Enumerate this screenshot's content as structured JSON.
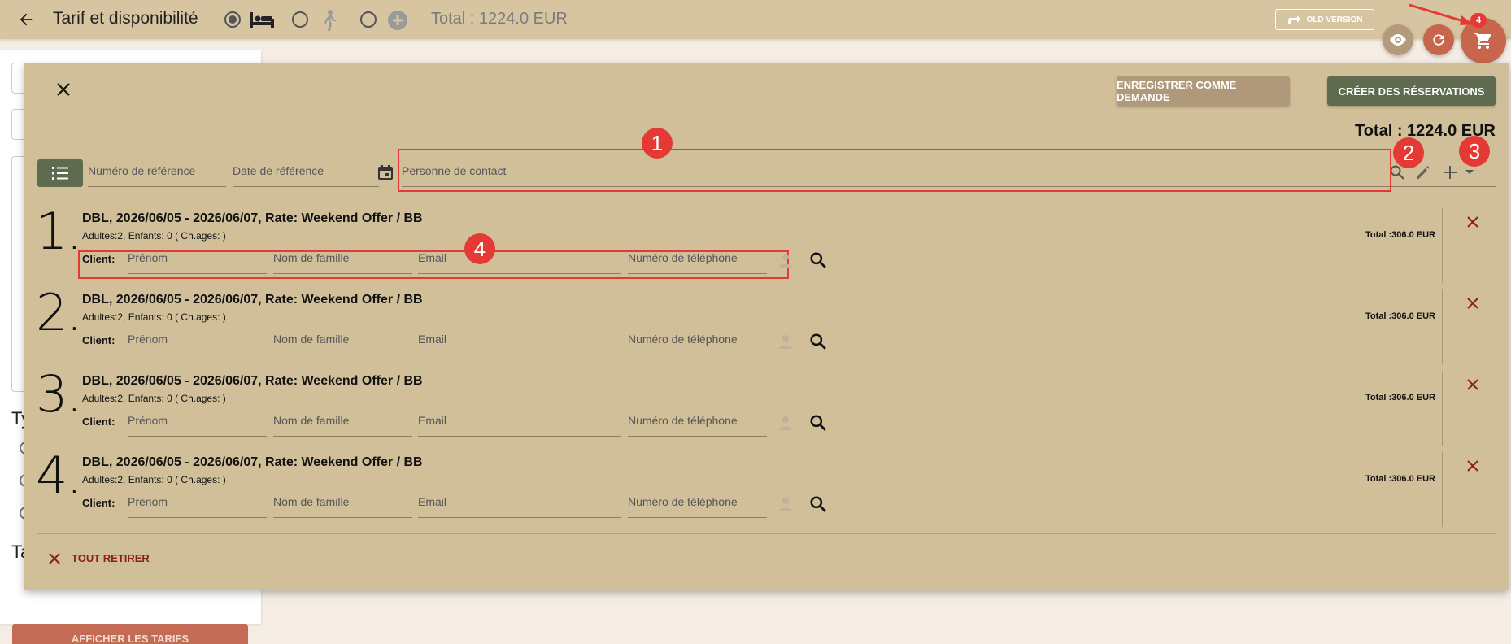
{
  "topbar": {
    "title": "Tarif et disponibilité",
    "total": "Total : 1224.0 EUR",
    "old_version_label": "OLD VERSION",
    "cart_badge": "4",
    "type_options": [
      "bed-icon",
      "walking-icon",
      "add-circle-icon"
    ],
    "selected_type": 0
  },
  "background": {
    "partial_texts": [
      "Ty",
      "Ta"
    ],
    "button_label": "AFFICHER LES TARIFS"
  },
  "panel": {
    "save_request_label": "ENREGISTRER COMME DEMANDE",
    "create_label": "CRÉER DES RÉSERVATIONS",
    "total": "Total : 1224.0 EUR",
    "reference_number_placeholder": "Numéro de référence",
    "reference_date_placeholder": "Date de référence",
    "contact_placeholder": "Personne de contact",
    "remove_all_label": "TOUT RETIRER",
    "annotations": [
      "1",
      "2",
      "3",
      "4"
    ],
    "client_label": "Client:",
    "client_fields": {
      "first_name": "Prénom",
      "last_name": "Nom de famille",
      "email": "Email",
      "phone": "Numéro de téléphone"
    },
    "reservations": [
      {
        "num": "1.",
        "title": "DBL, 2026/06/05 - 2026/06/07, Rate: Weekend Offer / BB",
        "guests": "Adultes:2, Enfants: 0 ( Ch.ages: )",
        "total": "Total :306.0 EUR"
      },
      {
        "num": "2.",
        "title": "DBL, 2026/06/05 - 2026/06/07, Rate: Weekend Offer / BB",
        "guests": "Adultes:2, Enfants: 0 ( Ch.ages: )",
        "total": "Total :306.0 EUR"
      },
      {
        "num": "3.",
        "title": "DBL, 2026/06/05 - 2026/06/07, Rate: Weekend Offer / BB",
        "guests": "Adultes:2, Enfants: 0 ( Ch.ages: )",
        "total": "Total :306.0 EUR"
      },
      {
        "num": "4.",
        "title": "DBL, 2026/06/05 - 2026/06/07, Rate: Weekend Offer / BB",
        "guests": "Adultes:2, Enfants: 0 ( Ch.ages: )",
        "total": "Total :306.0 EUR"
      }
    ]
  },
  "colors": {
    "topbar": "#d6c5a0",
    "panel": "#d1bf9a",
    "primary_button": "#5e6b4f",
    "secondary_button": "#b0987a",
    "annotation": "#e53935",
    "danger": "#8b1f1f"
  }
}
